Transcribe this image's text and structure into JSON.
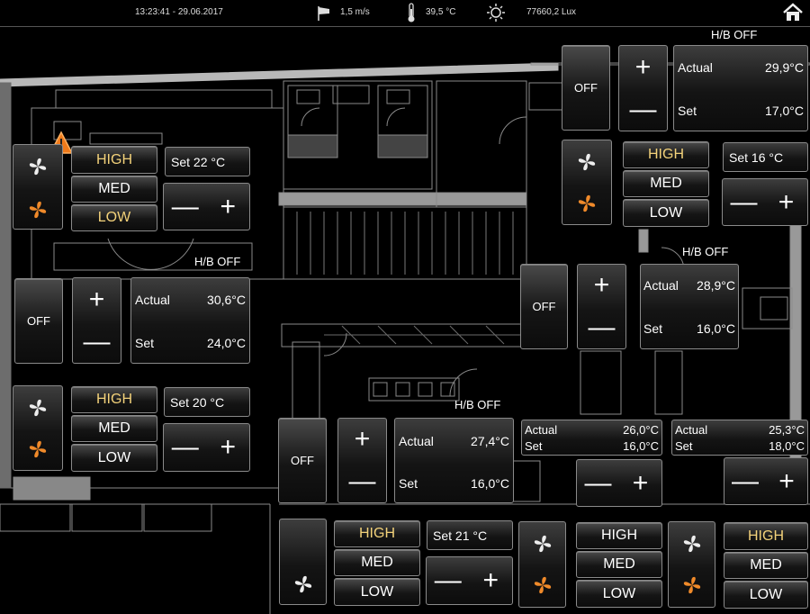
{
  "status": {
    "datetime": "13:23:41 - 29.06.2017",
    "wind": "1,5  m/s",
    "temperature": "39,5 °C",
    "light": "77660,2 Lux",
    "icons": {
      "wind": "wind-sock-icon",
      "thermo": "thermometer-icon",
      "sun": "sun-icon",
      "home": "home-icon"
    }
  },
  "labels": {
    "off": "OFF",
    "high": "HIGH",
    "med": "MED",
    "low": "LOW",
    "actual": "Actual",
    "set": "Set",
    "plus": "+",
    "minus": "—",
    "hb_off": "H/B OFF"
  },
  "fan_units": [
    {
      "set": "Set  22  °C",
      "selected": "high"
    },
    {
      "set": "Set  20  °C",
      "selected": "high"
    },
    {
      "set": "Set  16  °C",
      "selected": "high"
    },
    {
      "set": "Set  21  °C",
      "selected": "high"
    },
    {
      "selected": "none"
    },
    {
      "selected": "high"
    }
  ],
  "climate_zones": [
    {
      "actual": "29,9°C",
      "set": "17,0°C"
    },
    {
      "actual": "30,6°C",
      "set": "24,0°C"
    },
    {
      "actual": "28,9°C",
      "set": "16,0°C"
    },
    {
      "actual": "27,4°C",
      "set": "16,0°C"
    },
    {
      "actual": "26,0°C",
      "set": "16,0°C"
    },
    {
      "actual": "25,3°C",
      "set": "18,0°C"
    }
  ],
  "colors": {
    "selected_speed": "#f3d27a",
    "fan_active": "#f08a2a",
    "warning": "#f07a1a",
    "wall": "#b8b8b8"
  }
}
